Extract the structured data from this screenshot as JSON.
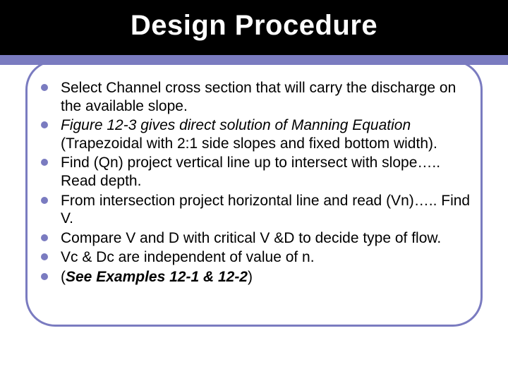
{
  "title": "Design Procedure",
  "bullets": [
    {
      "runs": [
        {
          "text": "Select Channel cross section that will carry the discharge on the available slope.",
          "style": ""
        }
      ]
    },
    {
      "runs": [
        {
          "text": " Figure 12-3 gives direct solution of Manning Equation",
          "style": "italic"
        },
        {
          "text": " (Trapezoidal with 2:1 side slopes and fixed bottom width).",
          "style": ""
        }
      ]
    },
    {
      "runs": [
        {
          "text": "Find (Qn) project vertical line up to intersect with slope….. Read depth.",
          "style": ""
        }
      ]
    },
    {
      "runs": [
        {
          "text": "From intersection project horizontal line and read (Vn)….. Find V.",
          "style": ""
        }
      ]
    },
    {
      "runs": [
        {
          "text": "Compare V and D with critical V &D to decide type of flow.",
          "style": ""
        }
      ]
    },
    {
      "runs": [
        {
          "text": "Vc & Dc are independent of value of n.",
          "style": ""
        }
      ]
    },
    {
      "runs": [
        {
          "text": "(",
          "style": ""
        },
        {
          "text": "See Examples 12-1 & 12-2",
          "style": "bolditalic"
        },
        {
          "text": ")",
          "style": ""
        }
      ]
    }
  ]
}
